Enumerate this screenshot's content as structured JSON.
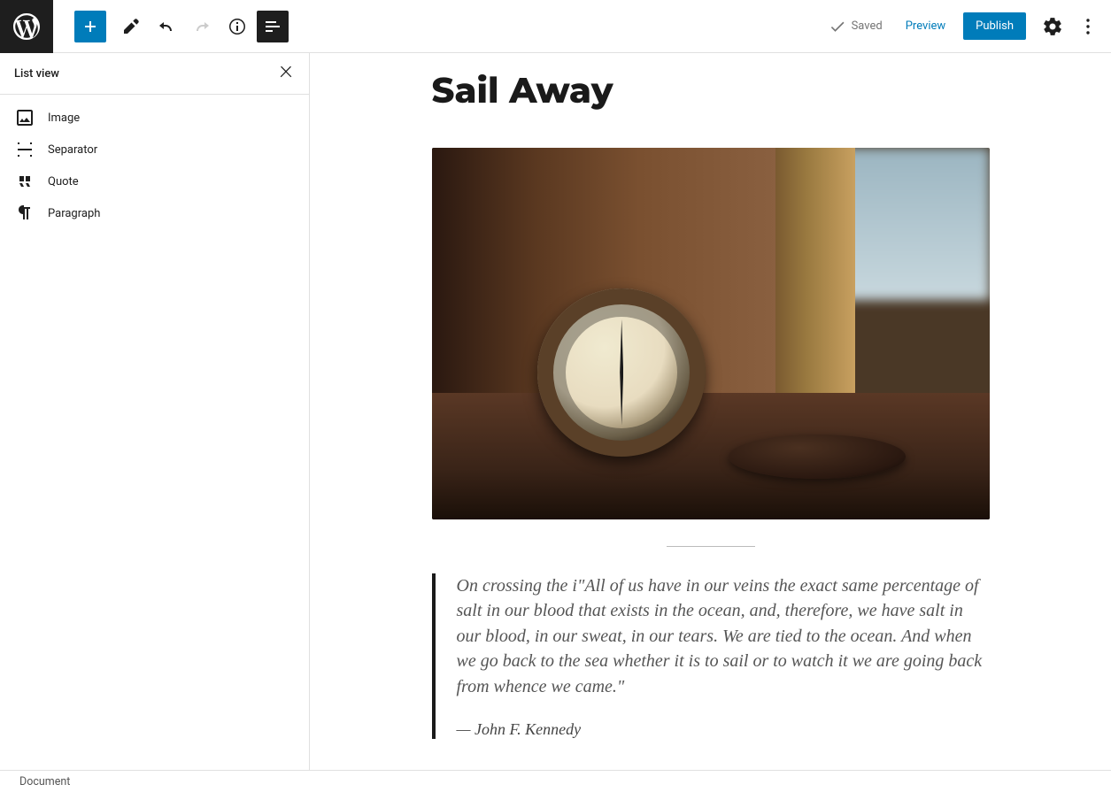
{
  "toolbar": {
    "saved_label": "Saved",
    "preview_label": "Preview",
    "publish_label": "Publish"
  },
  "sidebar": {
    "title": "List view",
    "items": [
      {
        "icon": "image-icon",
        "label": "Image"
      },
      {
        "icon": "separator-icon",
        "label": "Separator"
      },
      {
        "icon": "quote-icon",
        "label": "Quote"
      },
      {
        "icon": "paragraph-icon",
        "label": "Paragraph"
      }
    ]
  },
  "post": {
    "title": "Sail Away",
    "quote_text": "On crossing the i\"All of us have in our veins the exact same percentage of salt in our blood that exists in the ocean, and, therefore, we have salt in our blood, in our sweat, in our tears. We are tied to the ocean. And when we go back to the sea whether it is to sail or to watch it we are going back from whence we came.\"",
    "quote_citation": "John F. Kennedy"
  },
  "footer": {
    "breadcrumb": "Document"
  }
}
